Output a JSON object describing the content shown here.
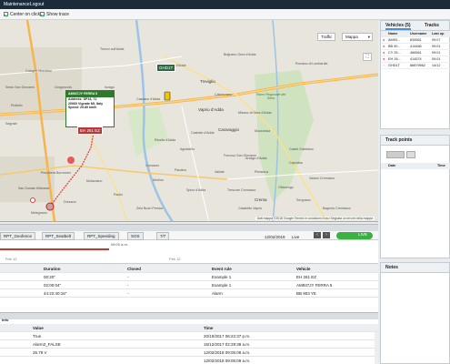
{
  "menubar": {
    "items": [
      "Maintenance",
      "Logout"
    ]
  },
  "toolbar": {
    "center_on_click": "Center on click",
    "show_trace": "Show trace"
  },
  "map": {
    "traffic_label": "Traffic",
    "maptype_label": "Mappa",
    "places": [
      "Vaprio d'Adda",
      "Treviglio",
      "Caravaggio",
      "Arzago d'Adda",
      "Crema",
      "Rivolta d'Adda",
      "Spino d'Adda",
      "Paullo",
      "San Donato Milanese",
      "Peschiera Borromeo",
      "Pioltello",
      "Melzo",
      "Segrate",
      "Cologno Monzese",
      "Cassano d'Adda",
      "Pandino",
      "Agnadello",
      "Brignano Gera d'Adda",
      "Fara Gera d'Adda",
      "Casirate d'Adda",
      "Mozzanica",
      "Romano di Lombardia",
      "Offanengo",
      "Vaiano Cremasco",
      "Melegnano",
      "Zelo Buon Persico",
      "Trezzo sull'Adda",
      "Sesto San Giovanni",
      "Inzago",
      "Gorgonzola",
      "Fornovo San Giovanni",
      "Calvenzano",
      "Misano di Gera d'Adda",
      "Sergnano",
      "Castel Gabbiano",
      "Pieranica",
      "Vailate",
      "Capralba",
      "Bagnolo Cremasco",
      "Trescore Cremasco",
      "Casaletto Vaprio",
      "Comazzo",
      "Merlino",
      "Dresano",
      "Mulazzano"
    ],
    "park_label": "Parco Regionale del Serio",
    "popup": {
      "title": "AM937JY FERRA 5",
      "address_label": "Address: SP14, 71",
      "address_line2": "20060 Vignate MI, Italy",
      "speed": "Speed: 29.80 km/h"
    },
    "vehicle_labels": [
      "GHD1T",
      "EH 261 EZ"
    ],
    "footer": "Dati mappa ©2018 Google   Termini e condizioni d'uso   Segnala un errore nella mappa"
  },
  "bottom": {
    "tabs": [
      "RPT_Geofence",
      "RPT_Seatbelt",
      "RPT_Speeding",
      "SOS",
      "7/7"
    ],
    "date": "12/02/2018",
    "live_label": "Live",
    "live_button": "LIVE",
    "timeline_time": "08:00 a.m.",
    "timeline_dates": [
      "Feb 12",
      "Feb 12"
    ],
    "events_headers": [
      "Duration",
      "Closed",
      "Event rule",
      "Vehicle"
    ],
    "events_rows": [
      [
        "00:20\"",
        "-",
        "Example 1",
        "EH 261 EZ"
      ],
      [
        "02:00:04\"",
        "-",
        "Example 1",
        "AM937JY FERRA 5"
      ],
      [
        "44:22:40:16\"",
        "-",
        "Alarm",
        "BB 903 YE"
      ]
    ],
    "details_title": "Info",
    "details_headers": [
      "Value",
      "Time"
    ],
    "details_rows": [
      [
        "True",
        "20/10/2017 06:22:37 p.m."
      ],
      [
        "Alarm2_FALSE",
        "15/12/2017 02:29:38 a.m."
      ],
      [
        "26.79 V",
        "12/02/2018 09:05:08 a.m."
      ],
      [
        "",
        "12/02/2018 09:05:09 a.m."
      ]
    ]
  },
  "vehicles": {
    "tabs": [
      "Vehicles (5)",
      "Tracks"
    ],
    "headers": [
      "Name",
      "Username",
      "Last up"
    ],
    "rows": [
      [
        "AM93...",
        "834561",
        "09:07"
      ],
      [
        "BB 90...",
        "414466",
        "09:01"
      ],
      [
        "CY 25...",
        "466561",
        "09:01"
      ],
      [
        "EH 26...",
        "414574",
        "09:01"
      ],
      [
        "GHD1T",
        "86879562",
        "14/12"
      ]
    ]
  },
  "trackpoints": {
    "title": "Track points",
    "headers": [
      "Date",
      "Time"
    ]
  },
  "notes": {
    "title": "Notes"
  },
  "colors": {
    "header": "#1b2b3c",
    "accent": "#4a90d9",
    "popup": "#2d7a2d",
    "live": "#3cb043"
  }
}
